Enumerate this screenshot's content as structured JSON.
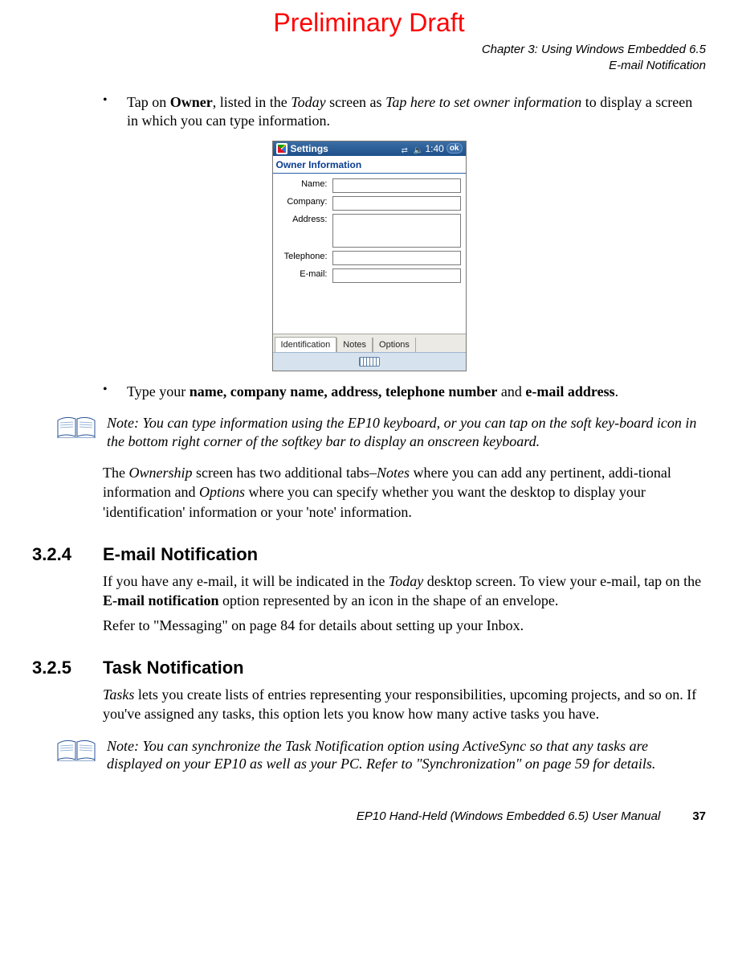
{
  "draft": "Preliminary Draft",
  "chapter": {
    "line1": "Chapter 3:  Using Windows Embedded 6.5",
    "line2": "E-mail Notification"
  },
  "bullet1": {
    "pre": "Tap on ",
    "owner": "Owner",
    "mid1": ", listed in the ",
    "today": "Today",
    "mid2": " screen as ",
    "tap_here": "Tap here to set owner information",
    "post": " to display a screen in which you can type information."
  },
  "screenshot": {
    "title": "Settings",
    "time": "1:40",
    "ok": "ok",
    "header": "Owner Information",
    "labels": {
      "name": "Name:",
      "company": "Company:",
      "address": "Address:",
      "telephone": "Telephone:",
      "email": "E-mail:"
    },
    "tabs": {
      "identification": "Identification",
      "notes": "Notes",
      "options": "Options"
    }
  },
  "bullet2": {
    "pre": "Type your ",
    "b1": "name, company name, address, telephone number",
    "mid": " and ",
    "b2": "e-mail address",
    "post": "."
  },
  "note1": {
    "label": "Note:",
    "text": "You can type information using the EP10 keyboard, or you can tap on the soft key-board icon in the bottom right corner of the softkey bar to display an onscreen keyboard."
  },
  "ownership_para": {
    "pre": "The ",
    "ownership": "Ownership",
    "mid1": " screen has two additional tabs–",
    "notes": "Notes",
    "mid2": " where you can add any pertinent, addi-tional information and ",
    "options": "Options",
    "post": " where you can specify whether you want the desktop to display your 'identification' information or your 'note' information."
  },
  "sec324": {
    "num": "3.2.4",
    "title": "E-mail Notification"
  },
  "email_p1": {
    "pre": "If you have any e-mail, it will be indicated in the ",
    "today": "Today",
    "mid": " desktop screen. To view your e-mail, tap on the ",
    "email_notif": "E-mail notification",
    "post": " option represented by an icon in the shape of an envelope."
  },
  "email_p2": "Refer to \"Messaging\" on page 84 for details about setting up your Inbox.",
  "sec325": {
    "num": "3.2.5",
    "title": "Task Notification"
  },
  "task_p1": {
    "tasks": "Tasks",
    "post": " lets you create lists of entries representing your responsibilities, upcoming projects, and so on. If you've assigned any tasks, this option lets you know how many active tasks you have."
  },
  "note2": {
    "label": "Note:",
    "text": "You can synchronize the Task Notification option using ActiveSync so that any tasks are displayed on your EP10 as well as your PC. Refer to \"Synchronization\" on page 59 for details."
  },
  "footer": {
    "manual": "EP10 Hand-Held (Windows Embedded 6.5) User Manual",
    "page": "37"
  }
}
